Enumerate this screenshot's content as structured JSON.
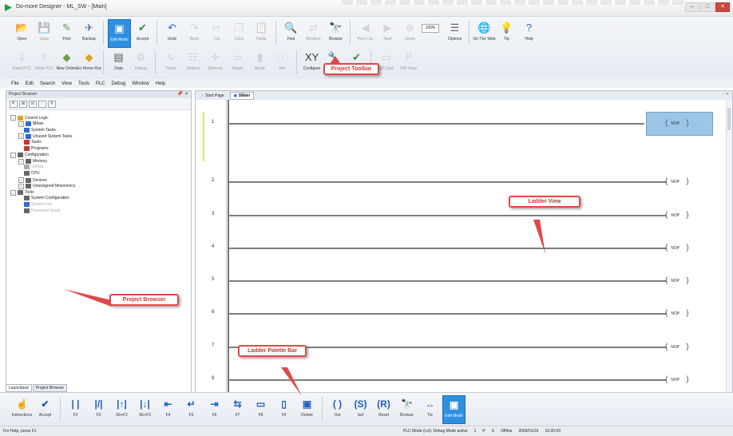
{
  "window": {
    "title": "Do-more Designer - ML_SW - [Main]",
    "buttons": [
      "–",
      "□",
      "✕"
    ]
  },
  "toolbar_row1": [
    {
      "label": "Open",
      "icon": "open-folder-icon",
      "glyph": "📂",
      "color": "#d9a520"
    },
    {
      "label": "Save",
      "icon": "save-icon",
      "glyph": "💾",
      "color": "#999",
      "disabled": true
    },
    {
      "label": "Print",
      "icon": "print-icon",
      "glyph": "✎",
      "color": "#6a9c4a"
    },
    {
      "label": "Backup",
      "icon": "backup-icon",
      "glyph": "✈",
      "color": "#4a6f9c"
    },
    {
      "label": "Edit Mode",
      "icon": "edit-mode-icon",
      "glyph": "▣",
      "color": "#fff",
      "active": true
    },
    {
      "label": "Accept",
      "icon": "accept-icon",
      "glyph": "✔",
      "color": "#2d8f3a"
    },
    {
      "label": "Undo",
      "icon": "undo-icon",
      "glyph": "↶",
      "color": "#2f6bcf"
    },
    {
      "label": "Redo",
      "icon": "redo-icon",
      "glyph": "↷",
      "color": "#999",
      "disabled": true
    },
    {
      "label": "Cut",
      "icon": "cut-icon",
      "glyph": "✂",
      "color": "#999",
      "disabled": true
    },
    {
      "label": "Copy",
      "icon": "copy-icon",
      "glyph": "❐",
      "color": "#999",
      "disabled": true
    },
    {
      "label": "Paste",
      "icon": "paste-icon",
      "glyph": "📋",
      "color": "#999",
      "disabled": true
    },
    {
      "label": "Find",
      "icon": "find-icon",
      "glyph": "🔍",
      "color": "#444"
    },
    {
      "label": "Replace",
      "icon": "replace-icon",
      "glyph": "⇄",
      "color": "#999",
      "disabled": true
    },
    {
      "label": "Browse",
      "icon": "browse-icon",
      "glyph": "🔭",
      "color": "#555"
    },
    {
      "label": "Prev Loc",
      "icon": "prev-location-icon",
      "glyph": "◀",
      "color": "#999",
      "disabled": true
    },
    {
      "label": "Next",
      "icon": "next-location-icon",
      "glyph": "▶",
      "color": "#999",
      "disabled": true
    },
    {
      "label": "Zoom",
      "icon": "zoom-icon",
      "glyph": "⊕",
      "color": "#999",
      "disabled": true
    },
    {
      "label": "Options",
      "icon": "options-icon",
      "glyph": "☰",
      "color": "#666"
    },
    {
      "label": "On The Web",
      "icon": "globe-icon",
      "glyph": "🌐",
      "color": "#2f6bcf"
    },
    {
      "label": "Tip",
      "icon": "tip-icon",
      "glyph": "💡",
      "color": "#d9a520"
    },
    {
      "label": "Help",
      "icon": "help-icon",
      "glyph": "?",
      "color": "#2f6bcf"
    }
  ],
  "zoom_value": "100%",
  "toolbar_row2": [
    {
      "label": "Read PLC",
      "icon": "read-plc-icon",
      "glyph": "⇩",
      "color": "#999",
      "disabled": true
    },
    {
      "label": "Write PLC",
      "icon": "write-plc-icon",
      "glyph": "⇧",
      "color": "#999",
      "disabled": true
    },
    {
      "label": "New Online",
      "icon": "new-online-icon",
      "glyph": "◆",
      "color": "#6a9c4a"
    },
    {
      "label": "Go Home Run",
      "icon": "home-run-icon",
      "glyph": "◆",
      "color": "#d9a520"
    },
    {
      "label": "Data",
      "icon": "data-icon",
      "glyph": "▤",
      "color": "#555"
    },
    {
      "label": "Debug",
      "icon": "debug-icon",
      "glyph": "⚙",
      "color": "#999",
      "disabled": true
    },
    {
      "label": "Trend",
      "icon": "trend-icon",
      "glyph": "∿",
      "color": "#999",
      "disabled": true
    },
    {
      "label": "Options",
      "icon": "prog-options-icon",
      "glyph": "☷",
      "color": "#999",
      "disabled": true
    },
    {
      "label": "Element",
      "icon": "element-icon",
      "glyph": "✛",
      "color": "#999",
      "disabled": true
    },
    {
      "label": "Shape",
      "icon": "shape-icon",
      "glyph": "▱",
      "color": "#999",
      "disabled": true
    },
    {
      "label": "Mode",
      "icon": "mode-icon",
      "glyph": "▮",
      "color": "#999",
      "disabled": true
    },
    {
      "label": "Info",
      "icon": "info-icon",
      "glyph": "ⓘ",
      "color": "#999",
      "disabled": true
    },
    {
      "label": "Configure",
      "icon": "configure-icon",
      "glyph": "XY",
      "color": "#333"
    },
    {
      "label": "Devices",
      "icon": "devices-icon",
      "glyph": "🔧",
      "color": "#555"
    },
    {
      "label": "Check",
      "icon": "check-icon",
      "glyph": "✔",
      "color": "#2d8f3a"
    },
    {
      "label": "SD Card",
      "icon": "sd-card-icon",
      "glyph": "▭",
      "color": "#999",
      "disabled": true
    },
    {
      "label": "PID View",
      "icon": "pid-view-icon",
      "glyph": "ℙ",
      "color": "#999",
      "disabled": true
    }
  ],
  "menu": [
    "File",
    "Edit",
    "Search",
    "View",
    "Tools",
    "PLC",
    "Debug",
    "Window",
    "Help"
  ],
  "project_browser": {
    "title": "Project Browser",
    "pin": "📌 ✕",
    "tools": [
      "⇱",
      "⊞",
      "⊟",
      "↕",
      "⚲"
    ],
    "tree": [
      {
        "label": "Control Logic",
        "depth": 0,
        "exp": "–",
        "icon": "folder",
        "color": "#d9a520"
      },
      {
        "label": "$Main",
        "depth": 1,
        "exp": "+",
        "icon": "program",
        "color": "#2f6bcf"
      },
      {
        "label": "System Tasks",
        "depth": 1,
        "exp": "",
        "icon": "program",
        "color": "#2f6bcf"
      },
      {
        "label": "Unused System Tasks",
        "depth": 1,
        "exp": "+",
        "icon": "program",
        "color": "#2f6bcf"
      },
      {
        "label": "Tasks",
        "depth": 1,
        "exp": "",
        "icon": "task",
        "color": "#c33"
      },
      {
        "label": "Programs",
        "depth": 1,
        "exp": "",
        "icon": "task",
        "color": "#c33"
      },
      {
        "label": "Configuration",
        "depth": 0,
        "exp": "–",
        "icon": "gear",
        "color": "#666"
      },
      {
        "label": "Memory",
        "depth": 1,
        "exp": "+",
        "icon": "memory",
        "color": "#666"
      },
      {
        "label": "Strings",
        "depth": 1,
        "exp": "",
        "icon": "memory",
        "color": "#aaa",
        "gray": true
      },
      {
        "label": "CPU",
        "depth": 1,
        "exp": "",
        "icon": "cpu",
        "color": "#666"
      },
      {
        "label": "Devices",
        "depth": 1,
        "exp": "+",
        "icon": "device",
        "color": "#666"
      },
      {
        "label": "Unassigned Mnemonics",
        "depth": 1,
        "exp": "+",
        "icon": "mnem",
        "color": "#666"
      },
      {
        "label": "Tools",
        "depth": 0,
        "exp": "–",
        "icon": "tool",
        "color": "#666"
      },
      {
        "label": "System Configuration",
        "depth": 1,
        "exp": "",
        "icon": "gear",
        "color": "#666"
      },
      {
        "label": "System Info",
        "depth": 1,
        "exp": "",
        "icon": "info",
        "color": "#2f6bcf",
        "gray": true
      },
      {
        "label": "Password Setup",
        "depth": 1,
        "exp": "",
        "icon": "key",
        "color": "#666",
        "gray": true
      }
    ],
    "bottom_tabs": [
      "Launchpad",
      "Project Browser"
    ]
  },
  "ladder": {
    "tabs": [
      {
        "label": "Start Page",
        "icon": "home"
      },
      {
        "label": "$Main",
        "icon": "code",
        "selected": true
      }
    ],
    "pin": "↑ ✕",
    "rungs": [
      "1",
      "2",
      "3",
      "4",
      "5",
      "6",
      "7",
      "8"
    ],
    "coil_label": "NOP"
  },
  "bottom_toolbar": [
    {
      "label": "Instructions",
      "glyph": "☝"
    },
    {
      "label": "Accept",
      "glyph": "✔"
    },
    {
      "label": "F2",
      "glyph": "| |"
    },
    {
      "label": "F3",
      "glyph": "|/|"
    },
    {
      "label": "Sh+F2",
      "glyph": "|↑|"
    },
    {
      "label": "Sh+F3",
      "glyph": "|↓|"
    },
    {
      "label": "F4",
      "glyph": "⇤"
    },
    {
      "label": "F5",
      "glyph": "↵"
    },
    {
      "label": "F6",
      "glyph": "⇥"
    },
    {
      "label": "F7",
      "glyph": "⇆"
    },
    {
      "label": "F8",
      "glyph": "▭"
    },
    {
      "label": "F9",
      "glyph": "▯"
    },
    {
      "label": "Delete",
      "glyph": "▣"
    },
    {
      "label": "Out",
      "glyph": "( )"
    },
    {
      "label": "Set",
      "glyph": "(S)"
    },
    {
      "label": "Reset",
      "glyph": "(R)"
    },
    {
      "label": "Browse",
      "glyph": "🔭"
    },
    {
      "label": "Tie",
      "glyph": "↔"
    },
    {
      "label": "Edit Mode",
      "glyph": "▣",
      "active": true
    }
  ],
  "callouts": [
    {
      "text": "Project Toolbar"
    },
    {
      "text": "Ladder View"
    },
    {
      "text": "Project Browser"
    },
    {
      "text": "Ladder Palette Bar"
    }
  ],
  "status": {
    "left": "For Help, press F1",
    "right": [
      "PLC Mode (Lcl): Debug Mode active",
      "1",
      "P",
      "S",
      "Offline",
      "2009/01/15",
      "10:35:53"
    ]
  }
}
